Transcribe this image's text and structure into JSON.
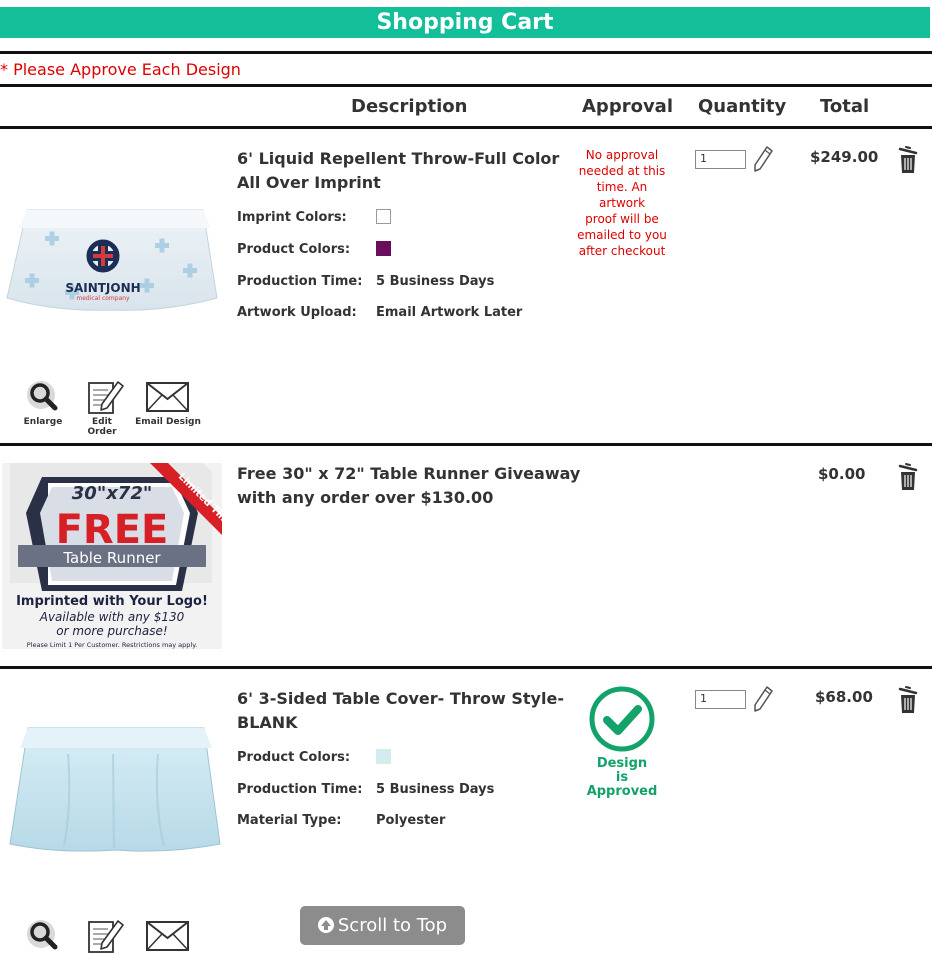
{
  "header": {
    "title": "Shopping Cart"
  },
  "notice": "* Please Approve Each Design",
  "columns": {
    "description": "Description",
    "approval": "Approval",
    "quantity": "Quantity",
    "total": "Total"
  },
  "items": [
    {
      "title_line1": "6' Liquid Repellent Throw-Full Color",
      "title_line2": "All Over Imprint",
      "specs": [
        {
          "label": "Imprint Colors:",
          "value": "",
          "color": "#ffffff"
        },
        {
          "label": "Product Colors:",
          "value": "",
          "color": "#6a0d5c"
        },
        {
          "label": "Production Time:",
          "value": "5 Business Days"
        },
        {
          "label": "Artwork Upload:",
          "value": "Email Artwork Later"
        }
      ],
      "approval_lines": [
        "No approval",
        "needed at this",
        "time. An artwork",
        "proof will be",
        "emailed to you",
        "after checkout"
      ],
      "quantity": "1",
      "total": "$249.00",
      "image_text": {
        "brand": "SAINTJONH",
        "sub": "medical company"
      },
      "actions": [
        "Enlarge",
        "Edit Order",
        "Email Design"
      ]
    },
    {
      "title_line1": "Free 30\" x 72\" Table Runner Giveaway",
      "title_line2": "with any order over $130.00",
      "total": "$0.00",
      "promo": {
        "size": "30\"x72\"",
        "free": "FREE",
        "runner": "Table Runner",
        "ribbon": "Limited Time Offer!",
        "line1": "Imprinted with Your Logo!",
        "line2": "Available with any $130",
        "line3": "or more purchase!",
        "line4": "Please Limit 1 Per Customer. Restrictions may apply."
      }
    },
    {
      "title_line1": "6' 3-Sided Table Cover- Throw Style-",
      "title_line2": "BLANK",
      "specs": [
        {
          "label": "Product Colors:",
          "value": "",
          "color": "#d2ecef"
        },
        {
          "label": "Production Time:",
          "value": "5 Business Days"
        },
        {
          "label": "Material Type:",
          "value": "Polyester"
        }
      ],
      "approved_lines": [
        "Design",
        "is",
        "Approved"
      ],
      "quantity": "1",
      "total": "$68.00"
    }
  ],
  "scroll_top": "Scroll to Top",
  "colors": {
    "header": "#12bf99",
    "alert": "#e00000",
    "approved": "#13a36a"
  }
}
